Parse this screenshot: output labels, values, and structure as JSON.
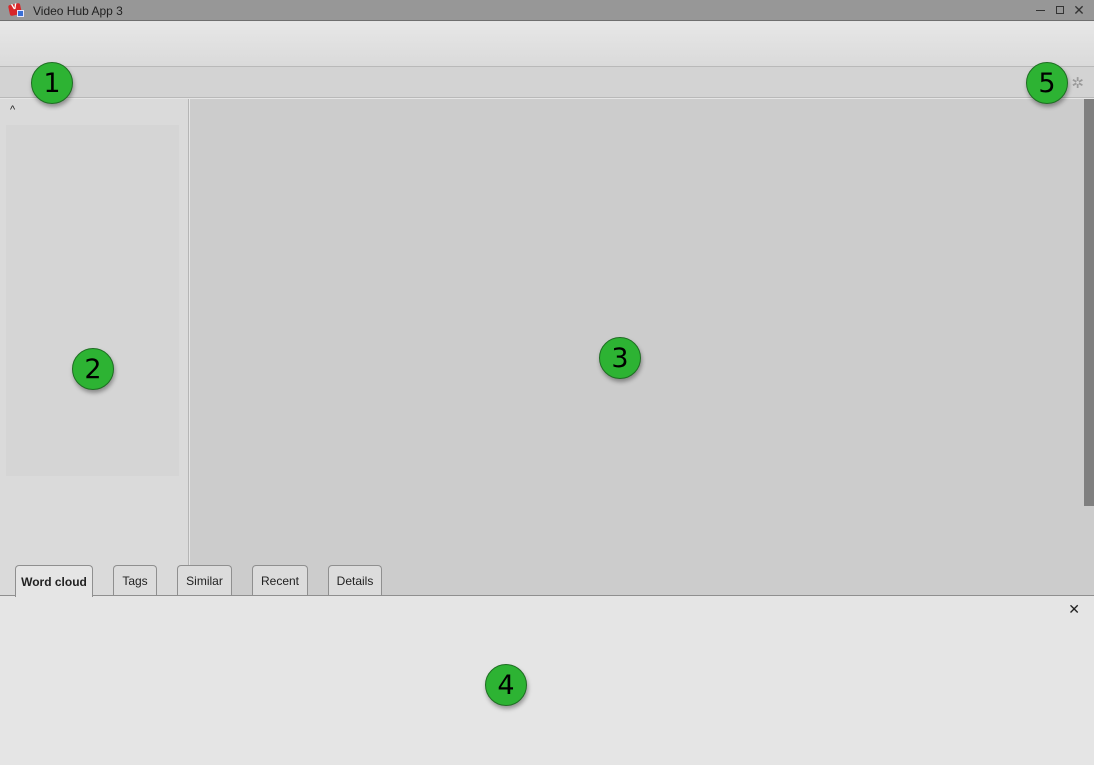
{
  "window": {
    "title": "Video Hub App 3",
    "app_icon": "video-hub-app-icon",
    "controls": {
      "minimize": "minimize-icon",
      "maximize": "maximize-icon",
      "close": "✕"
    }
  },
  "toolbar": {
    "settings_icon": "✲"
  },
  "sidebar": {
    "collapse_icon": "^"
  },
  "bottom_tabs": [
    {
      "label": "Word cloud",
      "active": true
    },
    {
      "label": "Tags",
      "active": false
    },
    {
      "label": "Similar",
      "active": false
    },
    {
      "label": "Recent",
      "active": false
    },
    {
      "label": "Details",
      "active": false
    }
  ],
  "bottom_panel": {
    "close_icon": "✕"
  },
  "markers": [
    "1",
    "2",
    "3",
    "4",
    "5"
  ]
}
